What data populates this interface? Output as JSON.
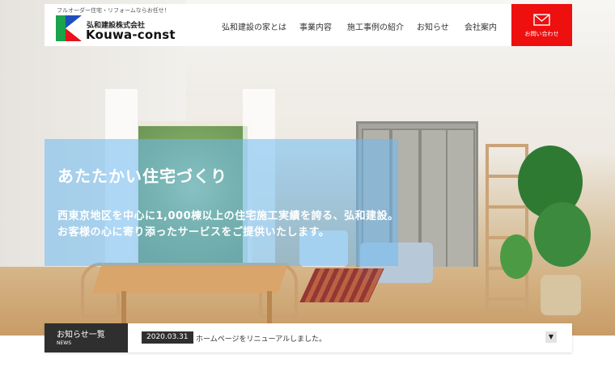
{
  "header": {
    "tagline": "フルオーダー住宅・リフォームならお任せ！",
    "company_jp": "弘和建設株式会社",
    "company_en": "Kouwa-const",
    "nav": [
      "弘和建設の家とは",
      "事業内容",
      "施工事例の紹介",
      "お知らせ",
      "会社案内"
    ],
    "contact_label": "お問い合わせ",
    "contact_icon": "mail-icon",
    "contact_color": "#ee0f0f"
  },
  "hero": {
    "title": "あたたかい住宅づくり",
    "line1": "西東京地区を中心に1,000棟以上の住宅施工実績を誇る、弘和建設。",
    "line2": "お客様の心に寄り添ったサービスをご提供いたします。"
  },
  "news": {
    "title": "お知らせ一覧",
    "subtitle": "NEWS",
    "date": "2020.03.31",
    "text": "ホームページをリニューアルしました。",
    "toggle": "▼"
  }
}
